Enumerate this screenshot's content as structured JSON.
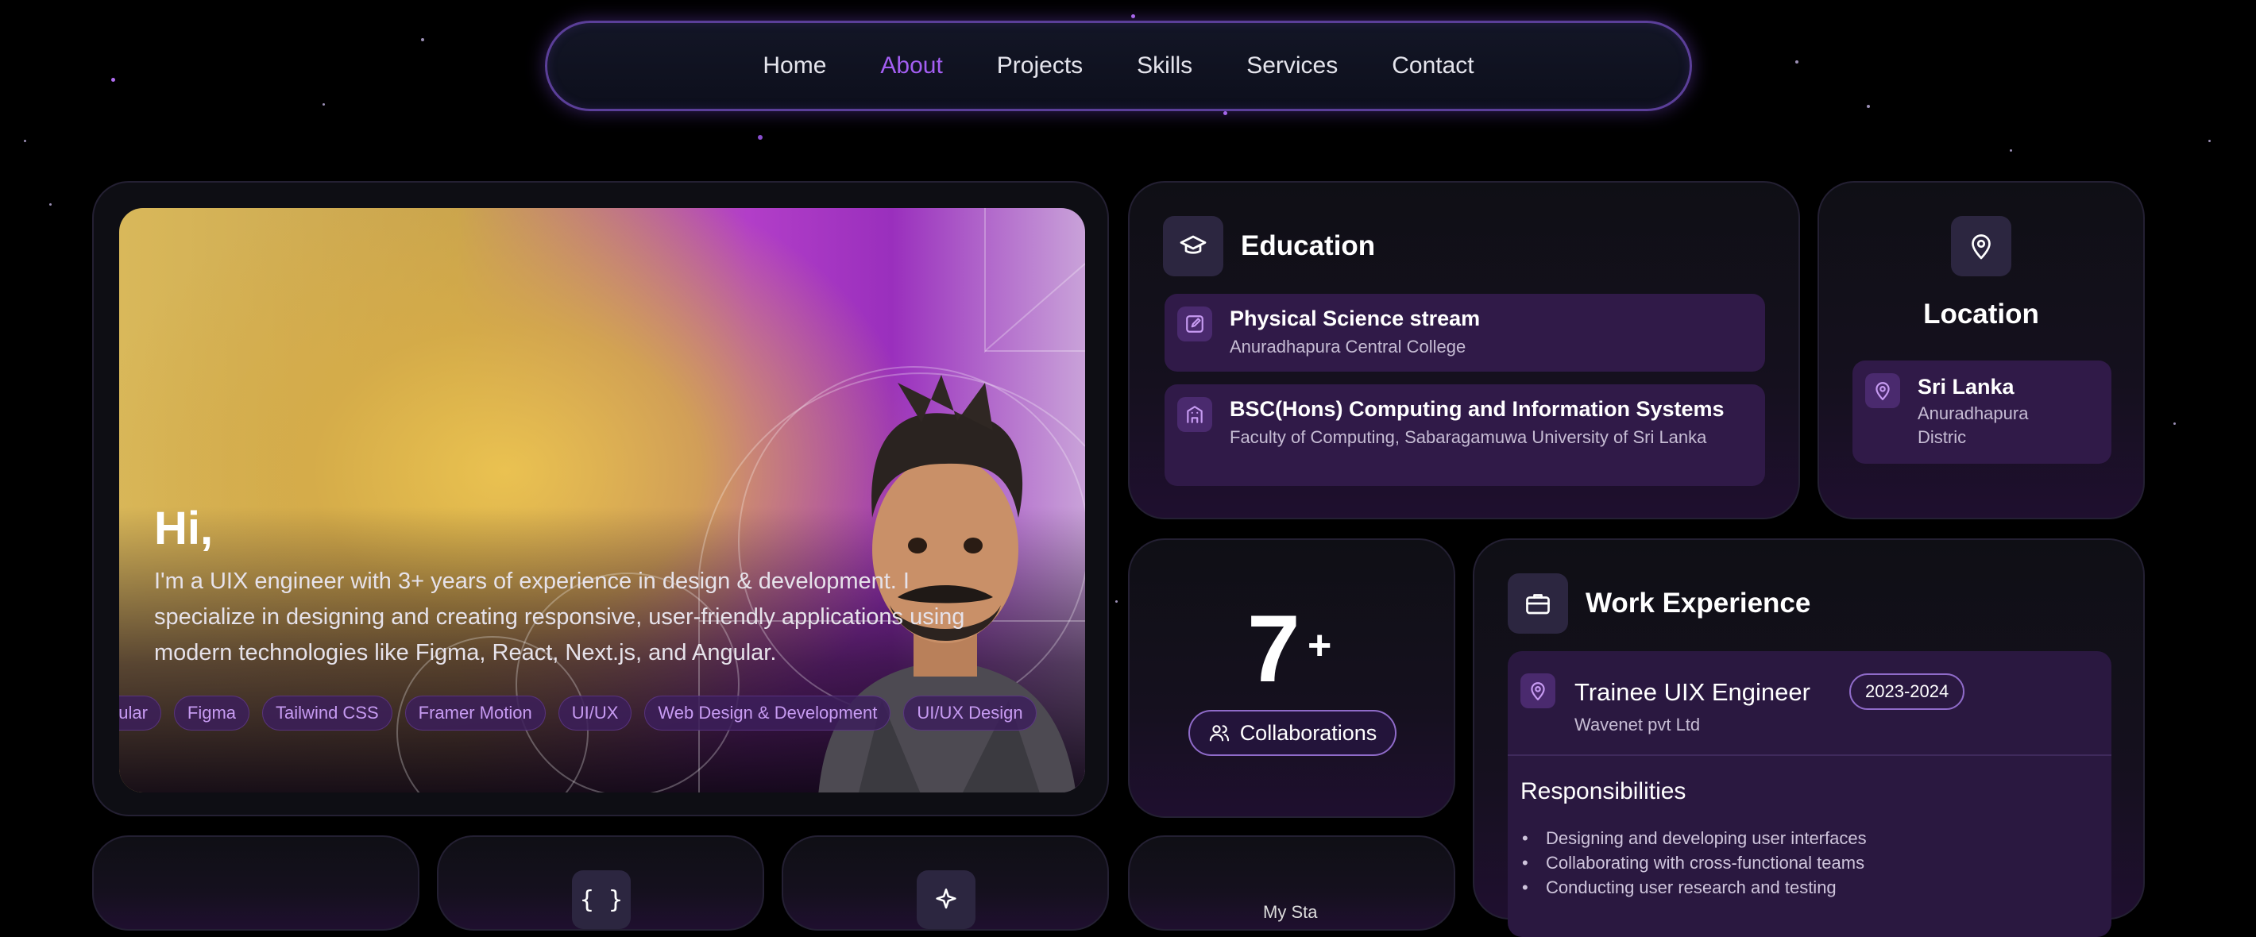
{
  "nav": {
    "items": [
      {
        "label": "Home",
        "active": false
      },
      {
        "label": "About",
        "active": true
      },
      {
        "label": "Projects",
        "active": false
      },
      {
        "label": "Skills",
        "active": false
      },
      {
        "label": "Services",
        "active": false
      },
      {
        "label": "Contact",
        "active": false
      }
    ]
  },
  "hero": {
    "title": "Hi,",
    "intro": "I'm a UIX engineer with 3+ years of experience in design & development. I specialize in designing and creating responsive, user-friendly applications using modern technologies like Figma, React, Next.js, and Angular.",
    "tags": [
      "gular",
      "Figma",
      "Tailwind CSS",
      "Framer Motion",
      "UI/UX",
      "Web Design & Development",
      "UI/UX Design"
    ]
  },
  "education": {
    "title": "Education",
    "items": [
      {
        "title": "Physical Science stream",
        "subtitle": "Anuradhapura Central College",
        "icon": "edit-icon"
      },
      {
        "title": "BSC(Hons) Computing and Information Systems",
        "subtitle": "Faculty of Computing, Sabaragamuwa University of Sri Lanka",
        "icon": "building-icon"
      }
    ]
  },
  "location": {
    "title": "Location",
    "place": "Sri Lanka",
    "detail": "Anuradhapura Distric"
  },
  "collaborations": {
    "count": "7",
    "suffix": "+",
    "label": "Collaborations"
  },
  "work": {
    "title": "Work Experience",
    "role": "Trainee UIX Engineer",
    "company": "Wavenet pvt Ltd",
    "years": "2023-2024",
    "responsibilities_title": "Responsibilities",
    "responsibilities": [
      "Designing and developing user interfaces",
      "Collaborating with cross-functional teams",
      "Conducting user research and testing"
    ]
  },
  "bottom": {
    "card2_icon": "{ }",
    "card4_partial": "My Sta"
  },
  "colors": {
    "accent": "#a35ef2",
    "card_item_bg": "#301a48",
    "nav_border": "#5b3f99",
    "tag_text": "#c79bf2"
  }
}
